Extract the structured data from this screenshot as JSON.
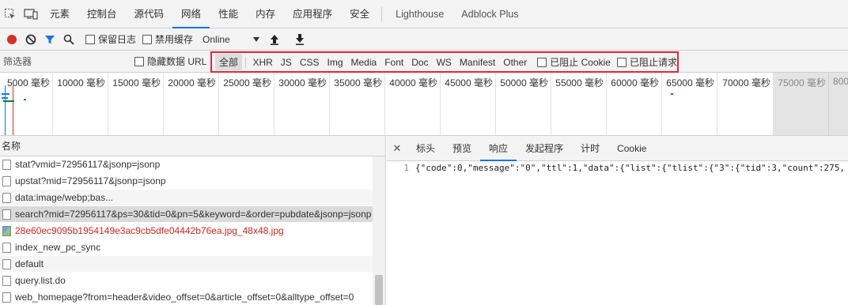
{
  "tabs": {
    "items": [
      "元素",
      "控制台",
      "源代码",
      "网络",
      "性能",
      "内存",
      "应用程序",
      "安全"
    ],
    "extensions": [
      "Lighthouse",
      "Adblock Plus"
    ],
    "active": "网络"
  },
  "toolbar": {
    "preserve_log": "保留日志",
    "disable_cache": "禁用缓存",
    "throttle": "Online"
  },
  "filterbar": {
    "placeholder": "筛选器",
    "hide_data_urls": "隐藏数据 URL",
    "types": [
      "全部",
      "XHR",
      "JS",
      "CSS",
      "Img",
      "Media",
      "Font",
      "Doc",
      "WS",
      "Manifest",
      "Other"
    ],
    "blocked_cookies": "已阻止 Cookie",
    "blocked_requests": "已阻止请求"
  },
  "timeline": {
    "ticks": [
      "5000 毫秒",
      "10000 毫秒",
      "15000 毫秒",
      "20000 毫秒",
      "25000 毫秒",
      "30000 毫秒",
      "35000 毫秒",
      "40000 毫秒",
      "45000 毫秒",
      "50000 毫秒",
      "55000 毫秒",
      "60000 毫秒",
      "65000 毫秒",
      "70000 毫秒",
      "75000 毫秒",
      "800"
    ]
  },
  "requests": {
    "header": "名称",
    "rows": [
      {
        "name": "stat?vmid=72956117&jsonp=jsonp",
        "style": ""
      },
      {
        "name": "upstat?mid=72956117&jsonp=jsonp",
        "style": ""
      },
      {
        "name": "data:image/webp;bas...",
        "style": "alt"
      },
      {
        "name": "search?mid=72956117&ps=30&tid=0&pn=5&keyword=&order=pubdate&jsonp=jsonp",
        "style": "sel"
      },
      {
        "name": "28e60ec9095b1954149e3ac9cb5dfe04442b76ea.jpg_48x48.jpg",
        "style": "red"
      },
      {
        "name": "index_new_pc_sync",
        "style": ""
      },
      {
        "name": "default",
        "style": "alt"
      },
      {
        "name": "query.list.do",
        "style": ""
      },
      {
        "name": "web_homepage?from=header&video_offset=0&article_offset=0&alltype_offset=0",
        "style": ""
      }
    ]
  },
  "details": {
    "tabs": [
      "标头",
      "预览",
      "响应",
      "发起程序",
      "计时",
      "Cookie"
    ],
    "active": "响应",
    "line_number": "1",
    "response": "{\"code\":0,\"message\":\"0\",\"ttl\":1,\"data\":{\"list\":{\"tlist\":{\"3\":{\"tid\":3,\"count\":275,"
  }
}
